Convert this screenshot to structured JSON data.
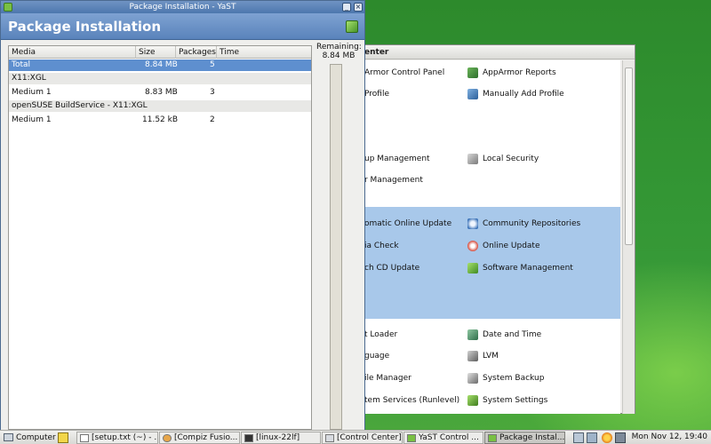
{
  "pkg_window": {
    "title": "Package Installation - YaST",
    "header_title": "Package Installation",
    "columns": [
      "Media",
      "Size",
      "Packages",
      "Time"
    ],
    "rows": [
      {
        "kind": "selected",
        "media": "Total",
        "size": "8.84 MB",
        "packages": "5",
        "time": ""
      },
      {
        "kind": "group",
        "media": "X11:XGL",
        "size": "",
        "packages": "",
        "time": ""
      },
      {
        "kind": "item",
        "media": "Medium 1",
        "size": "8.83 MB",
        "packages": "3",
        "time": ""
      },
      {
        "kind": "group",
        "media": "openSUSE BuildService - X11:XGL",
        "size": "",
        "packages": "",
        "time": ""
      },
      {
        "kind": "item",
        "media": "Medium 1",
        "size": "11.52 kB",
        "packages": "2",
        "time": ""
      }
    ],
    "remaining_label": "Remaining:",
    "remaining_value": "8.84 MB",
    "progress": 0
  },
  "cc_window": {
    "title": "enter",
    "items": [
      {
        "label": "Armor Control Panel",
        "icon": "none"
      },
      {
        "label": "AppArmor Reports",
        "icon": "apparmor-reports-icon"
      },
      {
        "label": "Profile",
        "icon": "none"
      },
      {
        "label": "Manually Add Profile",
        "icon": "add-profile-icon"
      },
      {
        "label": "up Management",
        "icon": "none"
      },
      {
        "label": "Local Security",
        "icon": "local-security-icon"
      },
      {
        "label": "r Management",
        "icon": "none"
      },
      {
        "label": "omatic Online Update",
        "icon": "none"
      },
      {
        "label": "Community Repositories",
        "icon": "community-repositories-icon"
      },
      {
        "label": "ia Check",
        "icon": "none"
      },
      {
        "label": "Online Update",
        "icon": "online-update-icon"
      },
      {
        "label": "ch CD Update",
        "icon": "none"
      },
      {
        "label": "Software Management",
        "icon": "software-management-icon"
      },
      {
        "label": "t Loader",
        "icon": "none"
      },
      {
        "label": "Date and Time",
        "icon": "date-time-icon"
      },
      {
        "label": "guage",
        "icon": "none"
      },
      {
        "label": "LVM",
        "icon": "lvm-icon"
      },
      {
        "label": "ile Manager",
        "icon": "none"
      },
      {
        "label": "System Backup",
        "icon": "system-backup-icon"
      },
      {
        "label": "tem Services (Runlevel)",
        "icon": "none"
      },
      {
        "label": "System Settings",
        "icon": "system-settings-icon"
      }
    ]
  },
  "taskbar": {
    "computer_label": "Computer",
    "tasks": [
      {
        "label": "[setup.txt (~) - ...",
        "icon": "text-editor-icon"
      },
      {
        "label": "[Compiz Fusio...",
        "icon": "browser-icon"
      },
      {
        "label": "[linux-22lf]",
        "icon": "terminal-icon"
      },
      {
        "label": "[Control Center]",
        "icon": "control-center-icon"
      },
      {
        "label": "YaST Control ...",
        "icon": "yast-icon"
      },
      {
        "label": "Package Instal...",
        "icon": "package-icon"
      }
    ],
    "clock": "Mon Nov 12, 19:40"
  },
  "colors": {
    "selection": "#5e8fcf",
    "header_blue": "#6f93c3",
    "desktop_green": "#2f8a2a",
    "cc_highlight": "#a8c8ea"
  }
}
